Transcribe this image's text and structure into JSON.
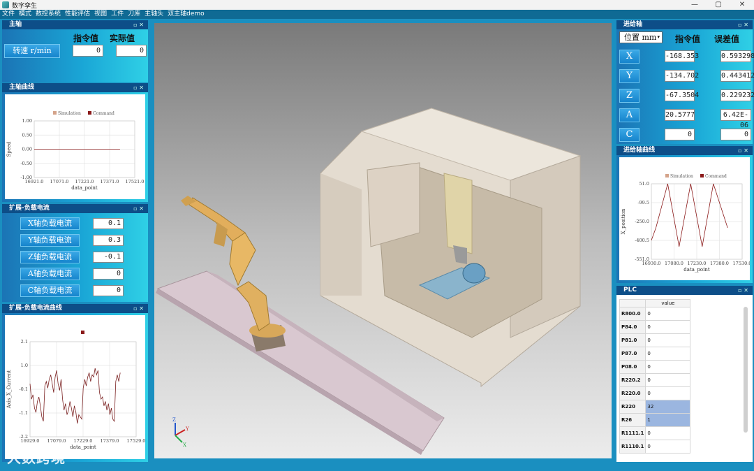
{
  "window": {
    "title": "数字孪生",
    "min": "—",
    "max": "▢",
    "close": "✕"
  },
  "menu": [
    "文件",
    "模式",
    "数控系统",
    "性能评估",
    "视图",
    "工件",
    "刀库",
    "主轴头",
    "双主轴demo"
  ],
  "spindle": {
    "title": "主轴",
    "cmd_label": "指令值",
    "act_label": "实际值",
    "speed_label": "转速 r/min",
    "cmd_value": "0",
    "act_value": "0"
  },
  "spindle_chart": {
    "title": "主轴曲线",
    "chart_data": {
      "type": "line",
      "legend": [
        "Simulation",
        "Command"
      ],
      "xlabel": "data_point",
      "ylabel": "Speed",
      "x_ticks": [
        "16921.0",
        "17071.0",
        "17221.0",
        "17371.0",
        "17521.0"
      ],
      "y_ticks": [
        "1.00",
        "0.50",
        "0.00",
        "-0.50",
        "-1.00"
      ],
      "ylim": [
        -1,
        1
      ],
      "xlim": [
        16921,
        17521
      ],
      "series": [
        {
          "name": "Simulation",
          "x": [
            16921,
            17433
          ],
          "y": [
            0,
            0
          ]
        }
      ]
    }
  },
  "load_current": {
    "title": "扩展-负载电流",
    "rows": [
      {
        "label": "X轴负载电流",
        "value": "0.1"
      },
      {
        "label": "Y轴负载电流",
        "value": "0.3"
      },
      {
        "label": "Z轴负载电流",
        "value": "-0.1"
      },
      {
        "label": "A轴负载电流",
        "value": "0"
      },
      {
        "label": "C轴负载电流",
        "value": "0"
      }
    ]
  },
  "current_chart": {
    "title": "扩展-负载电流曲线",
    "chart_data": {
      "type": "line",
      "xlabel": "data_point",
      "ylabel": "Axis_X_Current",
      "x_ticks": [
        "16929.0",
        "17079.0",
        "17229.0",
        "17379.0",
        "17529.0"
      ],
      "y_ticks": [
        "2.1",
        "1.0",
        "-0.1",
        "-1.1",
        "-2.2"
      ],
      "ylim": [
        -2.2,
        2.1
      ],
      "xlim": [
        16929,
        17529
      ],
      "series": [
        {
          "name": "",
          "y": [
            0.2,
            -0.5,
            -0.3,
            -0.9,
            -1.1,
            -0.6,
            -0.4,
            -0.8,
            -1.3,
            -1.5,
            0.1,
            0.3,
            0.0,
            0.4,
            0.6,
            0.2,
            -0.2,
            0.5,
            0.8,
            0.2,
            -0.1,
            0.4,
            -0.5,
            -1.0,
            -0.7,
            -1.2,
            -1.0,
            -0.6,
            -0.9,
            -1.3,
            -0.8,
            -1.1,
            -1.6,
            -1.2,
            -1.3,
            -1.4,
            0.0,
            0.4,
            0.1,
            0.5,
            0.7,
            0.3,
            0.6,
            0.5,
            0.9,
            0.6,
            0.8,
            -0.2,
            -0.5,
            -0.4,
            -0.8,
            -0.6,
            -1.0,
            -0.7,
            -1.2,
            -0.9,
            -1.4,
            -1.5,
            0.3,
            0.6,
            0.3,
            0.7
          ]
        }
      ]
    }
  },
  "feed": {
    "title": "进给轴",
    "mode_select": "位置 mm",
    "cmd_label": "指令值",
    "err_label": "误差值",
    "axes": [
      {
        "name": "X",
        "cmd": "-168.353",
        "err": "0.593298"
      },
      {
        "name": "Y",
        "cmd": "-134.702",
        "err": "0.443412"
      },
      {
        "name": "Z",
        "cmd": "-67.3504",
        "err": "0.229232"
      },
      {
        "name": "A",
        "cmd": "20.5777",
        "err": "6.42E-06"
      },
      {
        "name": "C",
        "cmd": "0",
        "err": "0"
      }
    ]
  },
  "feed_chart": {
    "title": "进给轴曲线",
    "chart_data": {
      "type": "line",
      "legend": [
        "Simulation",
        "Command"
      ],
      "xlabel": "data_point",
      "ylabel": "X_position",
      "x_ticks": [
        "16930.0",
        "17080.0",
        "17230.0",
        "17380.0",
        "17530.0"
      ],
      "y_ticks": [
        "51.0",
        "-99.5",
        "-250.0",
        "-400.5",
        "-551.0"
      ],
      "ylim": [
        -551,
        51
      ],
      "xlim": [
        16930,
        17530
      ],
      "series": [
        {
          "name": "Simulation",
          "x": [
            16930,
            16960,
            17038,
            17113,
            17190,
            17266,
            17340,
            17434
          ],
          "y": [
            -400,
            -300,
            51,
            -450,
            51,
            -450,
            51,
            -300
          ]
        }
      ]
    }
  },
  "plc": {
    "title": "PLC",
    "col_header": "value",
    "rows": [
      {
        "name": "R800.0",
        "value": "0",
        "sel": false
      },
      {
        "name": "P84.0",
        "value": "0",
        "sel": false
      },
      {
        "name": "P81.0",
        "value": "0",
        "sel": false
      },
      {
        "name": "P87.0",
        "value": "0",
        "sel": false
      },
      {
        "name": "P08.0",
        "value": "0",
        "sel": false
      },
      {
        "name": "R220.2",
        "value": "0",
        "sel": false
      },
      {
        "name": "R220.0",
        "value": "0",
        "sel": false
      },
      {
        "name": "R220",
        "value": "32",
        "sel": true
      },
      {
        "name": "R26",
        "value": "1",
        "sel": true
      },
      {
        "name": "R1111.1",
        "value": "0",
        "sel": false
      },
      {
        "name": "R1110.1",
        "value": "0",
        "sel": false
      }
    ]
  },
  "colors": {
    "sim": "#d4a38a",
    "cmd": "#8b1a1a",
    "panel_head": "#0d4e88"
  },
  "watermark": "大数跨境"
}
